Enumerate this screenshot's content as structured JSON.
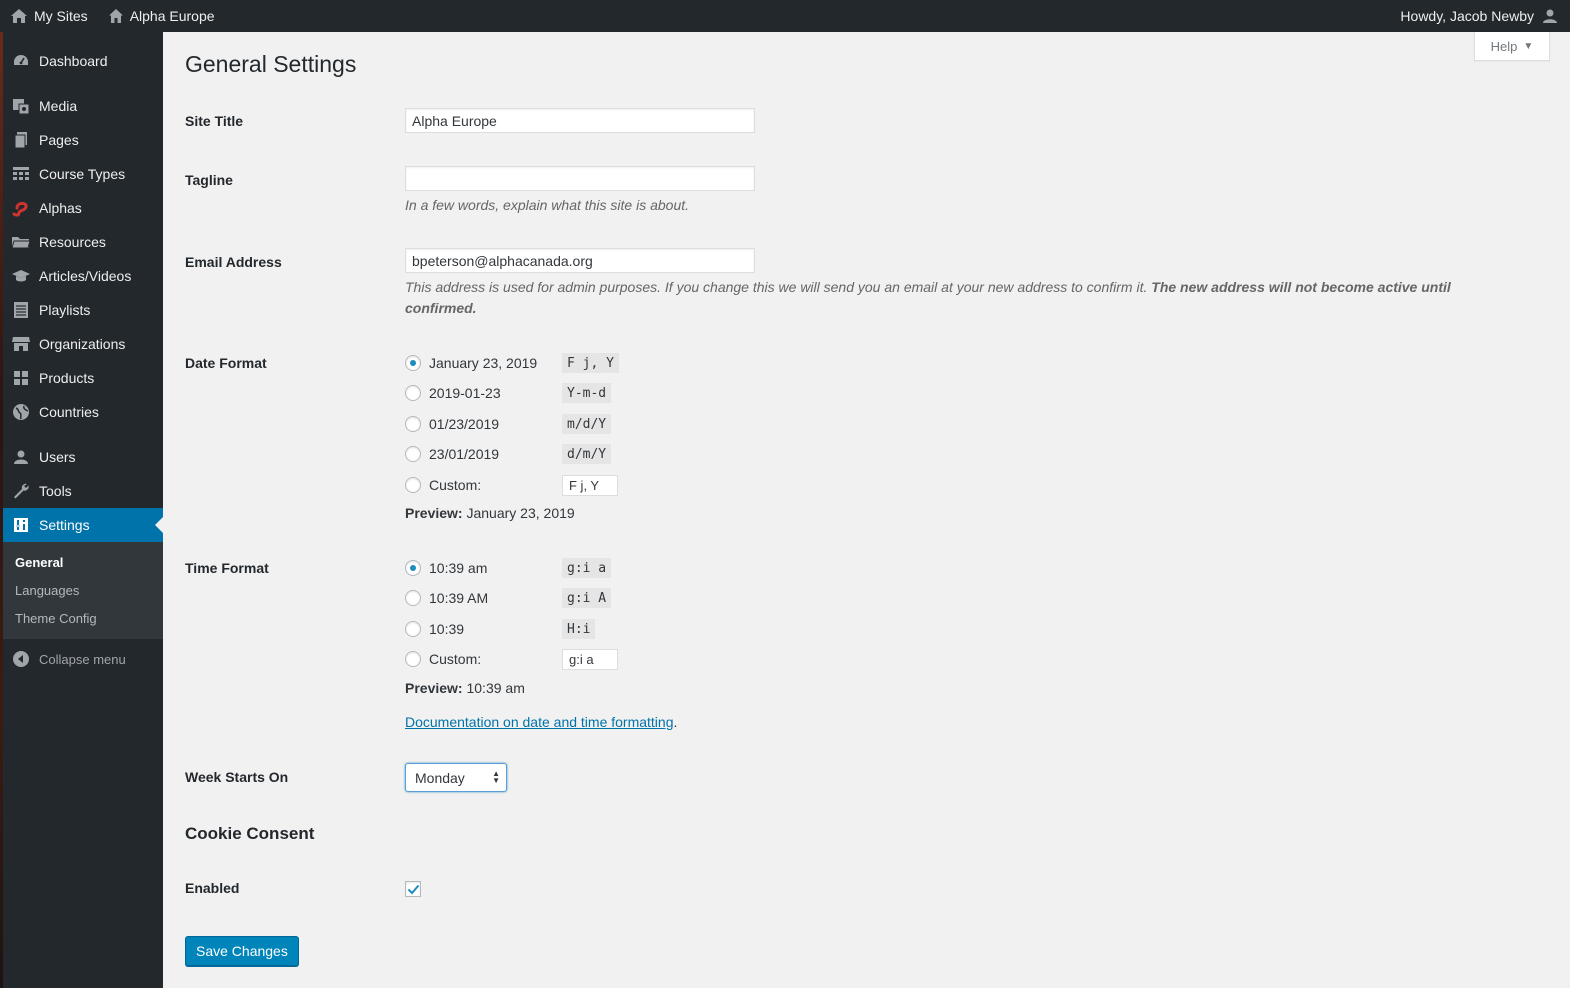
{
  "adminbar": {
    "my_sites": "My Sites",
    "site_name": "Alpha Europe",
    "howdy": "Howdy, Jacob Newby",
    "icons": [
      "my-sites-icon",
      "home-icon",
      "user-avatar-icon"
    ]
  },
  "sidebar": {
    "items": [
      {
        "label": "Dashboard",
        "icon": "dashboard-icon"
      },
      {
        "label": "Media",
        "icon": "media-icon"
      },
      {
        "label": "Pages",
        "icon": "pages-icon"
      },
      {
        "label": "Course Types",
        "icon": "table-icon"
      },
      {
        "label": "Alphas",
        "icon": "alphas-icon"
      },
      {
        "label": "Resources",
        "icon": "folder-icon"
      },
      {
        "label": "Articles/Videos",
        "icon": "graduation-cap-icon"
      },
      {
        "label": "Playlists",
        "icon": "list-icon"
      },
      {
        "label": "Organizations",
        "icon": "store-icon"
      },
      {
        "label": "Products",
        "icon": "grid-icon"
      },
      {
        "label": "Countries",
        "icon": "globe-icon"
      },
      {
        "label": "Users",
        "icon": "users-icon"
      },
      {
        "label": "Tools",
        "icon": "wrench-icon"
      },
      {
        "label": "Settings",
        "icon": "settings-icon"
      }
    ],
    "submenu": [
      "General",
      "Languages",
      "Theme Config"
    ],
    "collapse": "Collapse menu"
  },
  "help": "Help",
  "page_title": "General Settings",
  "site_title": {
    "label": "Site Title",
    "value": "Alpha Europe"
  },
  "tagline": {
    "label": "Tagline",
    "value": "",
    "description": "In a few words, explain what this site is about."
  },
  "email": {
    "label": "Email Address",
    "value": "bpeterson@alphacanada.org",
    "description": "This address is used for admin purposes. If you change this we will send you an email at your new address to confirm it.",
    "description_bold": "The new address will not become active until confirmed."
  },
  "date_format": {
    "label": "Date Format",
    "options": [
      {
        "label": "January 23, 2019",
        "code": "F j, Y",
        "checked": true
      },
      {
        "label": "2019-01-23",
        "code": "Y-m-d",
        "checked": false
      },
      {
        "label": "01/23/2019",
        "code": "m/d/Y",
        "checked": false
      },
      {
        "label": "23/01/2019",
        "code": "d/m/Y",
        "checked": false
      }
    ],
    "custom_label": "Custom:",
    "custom_value": "F j, Y",
    "preview_label": "Preview:",
    "preview_value": "January 23, 2019"
  },
  "time_format": {
    "label": "Time Format",
    "options": [
      {
        "label": "10:39 am",
        "code": "g:i a",
        "checked": true
      },
      {
        "label": "10:39 AM",
        "code": "g:i A",
        "checked": false
      },
      {
        "label": "10:39",
        "code": "H:i",
        "checked": false
      }
    ],
    "custom_label": "Custom:",
    "custom_value": "g:i a",
    "preview_label": "Preview:",
    "preview_value": "10:39 am"
  },
  "doc_link": "Documentation on date and time formatting",
  "doc_link_suffix": ".",
  "week_starts": {
    "label": "Week Starts On",
    "value": "Monday"
  },
  "cookie": {
    "heading": "Cookie Consent",
    "enabled_label": "Enabled",
    "enabled": true
  },
  "save_button": "Save Changes",
  "colors": {
    "adminbar": "#23282d",
    "accent": "#0073aa",
    "button": "#0085ba",
    "background": "#f1f1f1"
  }
}
